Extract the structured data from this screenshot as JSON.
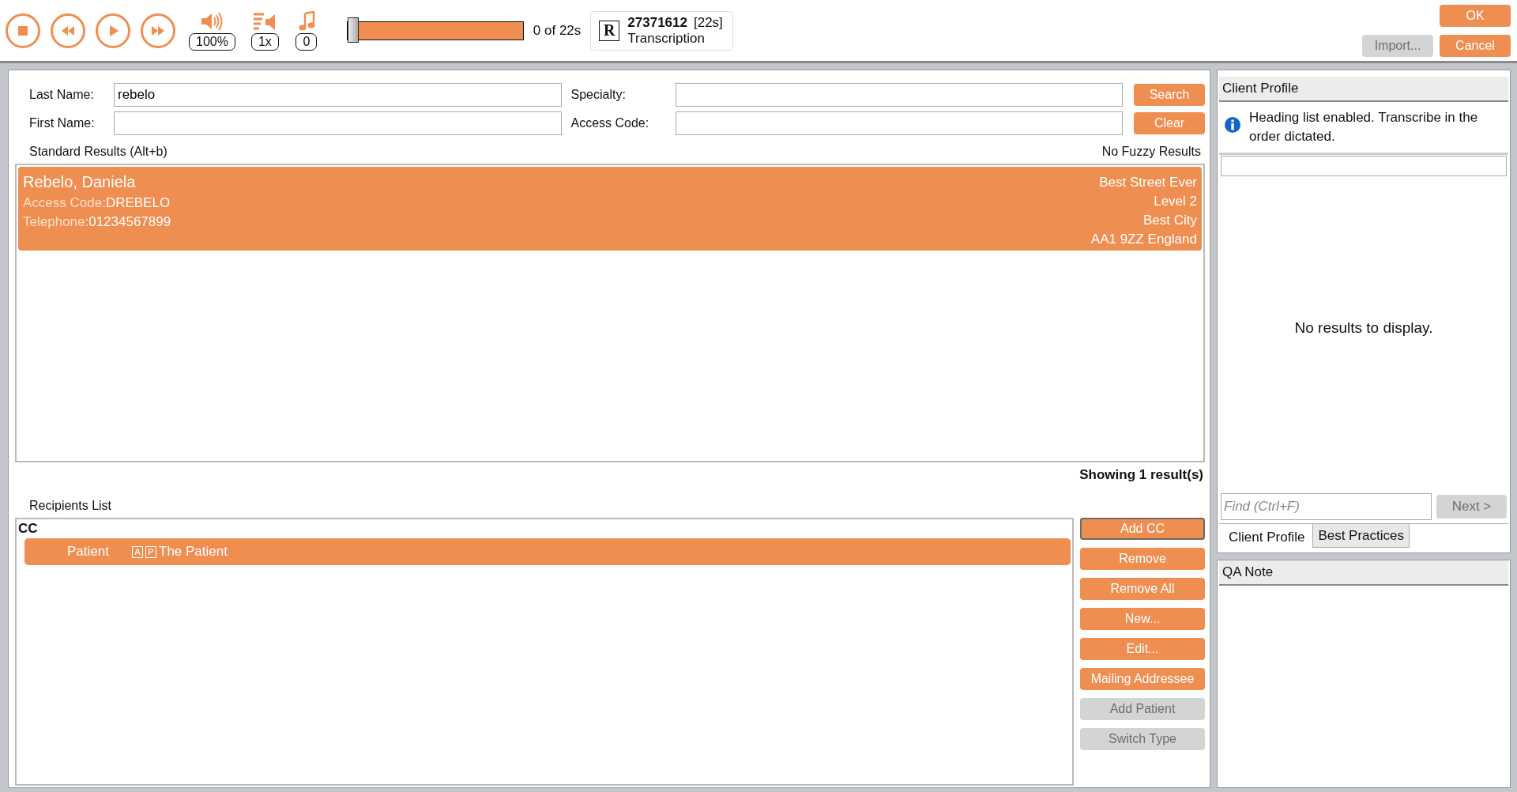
{
  "toolbar": {
    "volume": "100%",
    "speed": "1x",
    "pitch": "0",
    "position": {
      "level": 0
    },
    "time": "0 of 22s",
    "job": {
      "badge": "R",
      "number": "27371612",
      "duration": "[22s]",
      "type": "Transcription"
    }
  },
  "dialog_buttons": [
    {
      "label": "OK",
      "disabled": false
    },
    {
      "label": "Import...",
      "disabled": true
    },
    {
      "label": "Cancel",
      "disabled": false
    }
  ],
  "search_form": {
    "fields": [
      {
        "label": "Last Name:",
        "value": "rebelo"
      },
      {
        "label": "Specialty:"
      },
      {
        "label": "First Name:"
      },
      {
        "label": "Access Code:"
      }
    ],
    "buttons": [
      "Search",
      "Clear"
    ]
  },
  "results": {
    "heading": "Standard Results (Alt+b)",
    "fuzzy_status": "No Fuzzy Results",
    "rows": [
      {
        "name": "Rebelo, Daniela",
        "access_code_label": "Access Code:",
        "access_code": "DREBELO",
        "telephone_label": "Telephone:",
        "telephone": "01234567899",
        "address": [
          "Best Street Ever",
          "Level 2",
          "Best City",
          "AA1 9ZZ England"
        ],
        "selected": true
      }
    ],
    "count": "Showing 1 result(s)"
  },
  "recipients": {
    "heading": "Recipients List",
    "groups": [
      {
        "title": "CC",
        "items": [
          {
            "role": "Patient",
            "flags": [
              "A",
              "P"
            ],
            "name": "The Patient",
            "selected": true
          }
        ]
      }
    ],
    "buttons": [
      {
        "label": "Add CC",
        "disabled": false,
        "focused": true
      },
      {
        "label": "Remove",
        "disabled": false,
        "focused": false
      },
      {
        "label": "Remove All",
        "disabled": false,
        "focused": false
      },
      {
        "label": "New...",
        "disabled": false,
        "focused": false
      },
      {
        "label": "Edit...",
        "disabled": false,
        "focused": false
      },
      {
        "label": "Mailing Addressee",
        "disabled": false,
        "focused": false
      },
      {
        "label": "Add Patient",
        "disabled": true,
        "focused": false
      },
      {
        "label": "Switch Type",
        "disabled": true,
        "focused": false
      }
    ]
  },
  "client_profile": {
    "title": "Client Profile",
    "notice": "Heading list enabled. Transcribe in the order dictated.",
    "empty_message": "No results to display.",
    "find": {
      "placeholder": "Find (Ctrl+F)"
    },
    "next_button": {
      "label": "Next >",
      "disabled": true
    },
    "tabs": [
      {
        "label": "Client Profile",
        "selected": true
      },
      {
        "label": "Best Practices",
        "selected": false
      }
    ]
  },
  "qa_note": {
    "title": "QA Note"
  }
}
